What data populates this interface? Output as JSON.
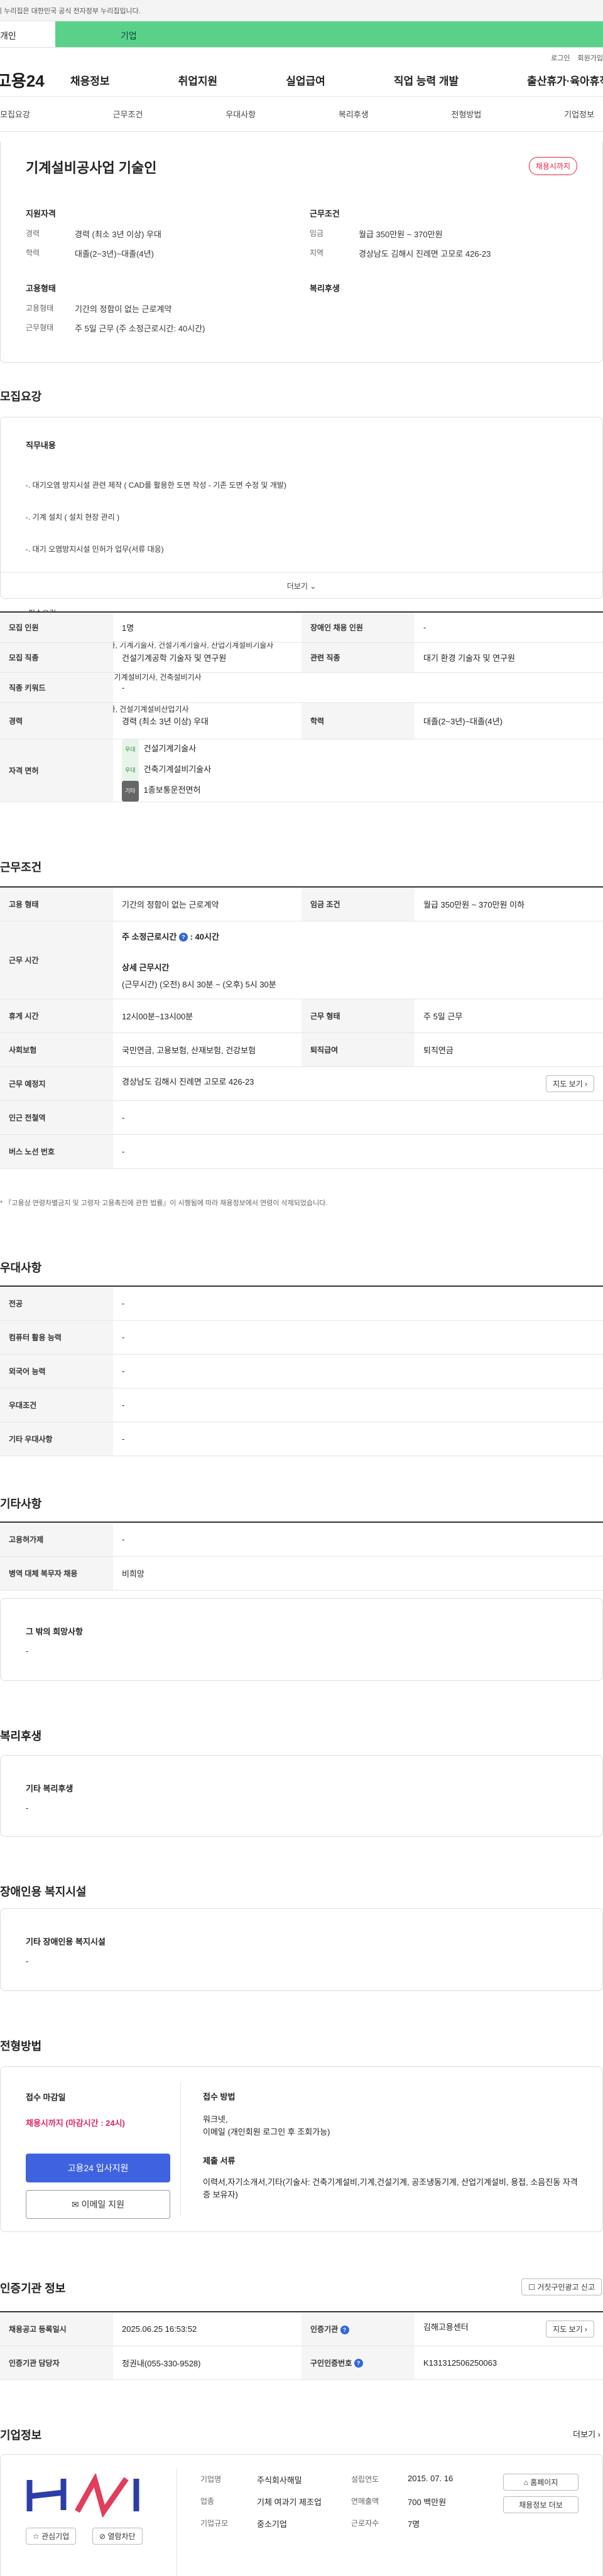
{
  "gov_banner": "이 누리집은 대한민국 공식 전자정부 누리집입니다.",
  "tabs": [
    "개인",
    "기업"
  ],
  "util": {
    "login": "로그인",
    "join": "회원가입"
  },
  "logo": "고용24",
  "gnb": [
    "채용정보",
    "취업지원",
    "실업급여",
    "직업 능력 개발",
    "출산휴가·육아휴직"
  ],
  "subnav": [
    "모집요강",
    "근무조건",
    "우대사항",
    "복리후생",
    "전형방법",
    "기업정보"
  ],
  "summary": {
    "title": "기계설비공사업 기술인",
    "status": "채용시까지",
    "qual_title": "지원자격",
    "career_l": "경력",
    "career_v": "경력 (최소 3년 이상) 우대",
    "edu_l": "학력",
    "edu_v": "대졸(2~3년)~대졸(4년)",
    "cond_title": "근무조건",
    "wage_l": "임금",
    "wage_v": "월급 350만원 ~ 370만원",
    "region_l": "지역",
    "region_v": "경상남도 김해시 진례면 고모로 426-23",
    "emp_title": "고용형태",
    "emptype_l": "고용형태",
    "emptype_v": "기간의 정함이 없는 근로계약",
    "worktype_l": "근무형태",
    "worktype_v": "주 5일 근무 (주 소정근로시간: 40시간)",
    "welfare_title": "복리후생"
  },
  "recruit": {
    "title": "모집요강",
    "duty_title": "직무내용",
    "duty_lines": [
      "-. 대기오염 방지시설 관련 제작 ( CAD를 활용한 도면 작성 - 기존 도면 수정 및 개발)",
      "-. 기계 설치 ( 설치 현장 관리 )",
      "-. 대기 오염방지시설 인허가 업무(서류 대응)",
      "",
      "-필수요건",
      "기술사 : 건축기계설비기술사, 기계기술사, 건설기계기술사, 산업기계설비기술사",
      "기    사 : 일반기계기사, 건설기계설비기사, 건축설비기사",
      "산업기사 : 건축설비산업기사, 건설기계설비산업기사"
    ],
    "more": "더보기",
    "rows": {
      "count_l": "모집 인원",
      "count_v": "1명",
      "disabled_l": "장애인 채용 인원",
      "disabled_v": "-",
      "job_l": "모집 직종",
      "job_v": "건설기계공학 기술자 및 연구원",
      "rel_l": "관련 직종",
      "rel_v": "대기 환경 기술자 및 연구원",
      "kw_l": "직종 키워드",
      "kw_v": "-",
      "career_l": "경력",
      "career_v": "경력 (최소 3년 이상) 우대",
      "edu_l": "학력",
      "edu_v": "대졸(2~3년)~대졸(4년)",
      "lic_l": "자격 면허",
      "licenses": [
        {
          "badge": "우대",
          "name": "건설기계기술사"
        },
        {
          "badge": "우대",
          "name": "건축기계설비기술사"
        },
        {
          "badge": "기타",
          "name": "1종보통운전면허"
        }
      ]
    }
  },
  "work": {
    "title": "근무조건",
    "emp_l": "고용 형태",
    "emp_v": "기간의 정함이 없는 근로계약",
    "wage_l": "임금 조건",
    "wage_v": "월급 350만원 ~ 370만원 이하",
    "hours_l": "근무 시간",
    "weekly_label": "주 소정근로시간",
    "weekly_v": "40시간",
    "detail_label": "상세 근무시간",
    "detail_v": "(근무시간) (오전) 8시 30분 ~ (오후) 5시 30분",
    "rest_l": "휴게 시간",
    "rest_v": "12시00분~13시00분",
    "form_l": "근무 형태",
    "form_v": "주 5일 근무",
    "ins_l": "사회보험",
    "ins_v": "국민연금, 고용보험, 산재보험, 건강보험",
    "ret_l": "퇴직급여",
    "ret_v": "퇴직연금",
    "place_l": "근무 예정지",
    "place_v": "경상남도 김해시 진례면 고모로 426-23",
    "map_btn": "지도 보기",
    "subway_l": "인근 전철역",
    "subway_v": "-",
    "bus_l": "버스 노선 번호",
    "bus_v": "-",
    "note": "* 『고용상 연령차별금지 및 고령자 고용촉진에 관한 법률』이 시행됨에 따라 채용정보에서 연령이 삭제되었습니다."
  },
  "pref": {
    "title": "우대사항",
    "rows": [
      [
        "전공",
        "-"
      ],
      [
        "컴퓨터 활용 능력",
        "-"
      ],
      [
        "외국어 능력",
        "-"
      ],
      [
        "우대조건",
        "-"
      ],
      [
        "기타 우대사항",
        "-"
      ]
    ]
  },
  "etc": {
    "title": "기타사항",
    "rows": [
      [
        "고용허가제",
        "-"
      ],
      [
        "병역 대체 복무자 채용",
        "비희망"
      ]
    ],
    "hope_title": "그 밖의 희망사항",
    "hope_v": "-"
  },
  "welfare": {
    "title": "복리후생",
    "box_title": "기타 복리후생",
    "box_v": "-"
  },
  "disabled": {
    "title": "장애인용 복지시설",
    "box_title": "기타 장애인용 복지시설",
    "box_v": "-"
  },
  "screening": {
    "title": "전형방법",
    "deadline_l": "접수 마감일",
    "deadline_v": "채용시까지 (마감시간 : 24시)",
    "apply_btn": "고용24 입사지원",
    "email_btn": "이메일 지원",
    "method_l": "접수 방법",
    "method_v1": "워크넷,",
    "method_v2": "이메일 (개인회원 로그인 후 조회가능)",
    "docs_l": "제출 서류",
    "docs_v": "이력서,자기소개서,기타(기술사: 건축기계설비,기계,건설기계, 공조냉동기계, 산업기계설비, 용접, 소음진동 자격증 보유자)"
  },
  "cert": {
    "title": "인증기관 정보",
    "report_btn": "거짓구인광고 신고",
    "reg_l": "채용공고 등록일시",
    "reg_v": "2025.06.25 16:53:52",
    "agency_l": "인증기관",
    "agency_v": "김해고용센터",
    "mgr_l": "인증기관 담당자",
    "mgr_v": "정권내(055-330-9528)",
    "id_l": "구인인증번호",
    "id_v": "K131312506250063",
    "map_btn": "지도 보기"
  },
  "company": {
    "title": "기업정보",
    "more": "더보기",
    "name_l": "기업명",
    "name_v": "주식회사해밀",
    "founded_l": "설립연도",
    "founded_v": "2015. 07. 16",
    "ind_l": "업종",
    "ind_v": "기체 여과기 제조업",
    "sales_l": "연매출액",
    "sales_v": "700 백만원",
    "size_l": "기업규모",
    "size_v": "중소기업",
    "emp_l": "근로자수",
    "emp_v": "7명",
    "interest_btn": "관심기업",
    "block_btn": "열람차단",
    "home_btn": "홈페이지",
    "list_btn": "채용정보 더보"
  }
}
